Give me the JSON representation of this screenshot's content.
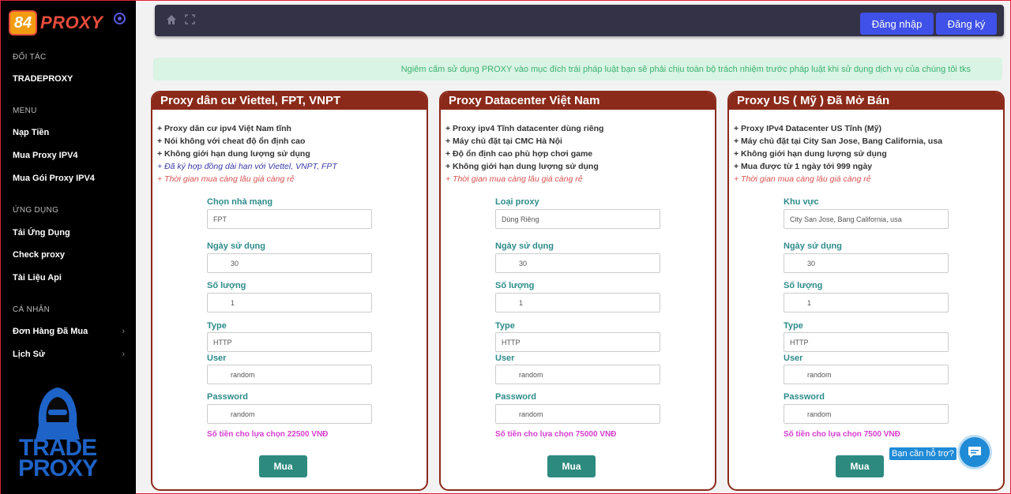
{
  "sidebar": {
    "brand": "PROXY",
    "logo_badge": "84",
    "sections": {
      "partner": "ĐỐI TÁC",
      "menu": "MENU",
      "apps": "ỨNG DỤNG",
      "personal": "CÁ NHÂN"
    },
    "partner_item": "TRADEPROXY",
    "menu_items": [
      "Nạp Tiền",
      "Mua Proxy IPV4",
      "Mua Gói Proxy IPV4"
    ],
    "app_items": [
      "Tải Ứng Dụng",
      "Check proxy",
      "Tài Liệu Api"
    ],
    "personal_items": [
      "Đơn Hàng Đã Mua",
      "Lịch Sử"
    ],
    "logo_line1": "TRADE",
    "logo_line2": "PROXY"
  },
  "topbar": {
    "login": "Đăng nhập",
    "register": "Đăng ký"
  },
  "notice": "Ngiêm cấm sử dụng PROXY vào mục đích trái pháp luật bạn sẽ phải chịu toàn bộ trách nhiệm trước pháp luật khi sử dụng dịch vụ của chúng tôi tks",
  "cards": [
    {
      "title": "Proxy dân cư Viettel, FPT, VNPT",
      "features": [
        "+ Proxy dân cư ipv4 Việt Nam tĩnh",
        "+ Nói không với cheat độ ổn định cao",
        "+ Không giới hạn dung lượng sử dụng"
      ],
      "highlight_blue": "+ Đã ký hợp đồng dài hạn với Viettel, VNPT, FPT",
      "highlight_red": "+ Thời gian mua càng lâu giá càng rẻ",
      "field1_label": "Chọn nhà mạng",
      "field1_value": "FPT",
      "days_label": "Ngày sử dụng",
      "days_value": "30",
      "qty_label": "Số lượng",
      "qty_value": "1",
      "type_label": "Type",
      "type_value": "HTTP",
      "user_label": "User",
      "user_value": "random",
      "pass_label": "Password",
      "pass_value": "random",
      "price": "Số tiền cho lựa chọn 22500 VNĐ",
      "buy": "Mua"
    },
    {
      "title": "Proxy Datacenter Việt Nam",
      "features": [
        "+ Proxy ipv4 Tĩnh datacenter dùng riêng",
        "+ Máy chủ đặt tại CMC Hà Nội",
        "+ Độ ổn định cao phù hợp chơi game",
        "+ Không giới hạn dung lượng sử dụng"
      ],
      "highlight_red": "+ Thời gian mua càng lâu giá càng rẻ",
      "field1_label": "Loại proxy",
      "field1_value": "Dùng Riêng",
      "days_label": "Ngày sử dụng",
      "days_value": "30",
      "qty_label": "Số lượng",
      "qty_value": "1",
      "type_label": "Type",
      "type_value": "HTTP",
      "user_label": "User",
      "user_value": "random",
      "pass_label": "Password",
      "pass_value": "random",
      "price": "Số tiền cho lựa chọn 75000 VNĐ",
      "buy": "Mua"
    },
    {
      "title": "Proxy US ( Mỹ ) Đã Mở Bán",
      "features": [
        "+ Proxy IPv4 Datacenter US Tĩnh (Mỹ)",
        "+ Máy chủ đặt tại City San Jose, Bang California, usa",
        "+ Không giới hạn dung lượng sử dụng",
        "+ Mua được từ 1 ngày tới 999 ngày"
      ],
      "highlight_red": "+ Thời gian mua càng lâu giá càng rẻ",
      "field1_label": "Khu vực",
      "field1_value": "City San Jose, Bang California, usa",
      "days_label": "Ngày sử dụng",
      "days_value": "30",
      "qty_label": "Số lượng",
      "qty_value": "1",
      "type_label": "Type",
      "type_value": "HTTP",
      "user_label": "User",
      "user_value": "random",
      "pass_label": "Password",
      "pass_value": "random",
      "price": "Số tiền cho lựa chọn 7500 VNĐ",
      "buy": "Mua"
    }
  ],
  "help": {
    "text": "Bạn cần hỗ trợ?"
  }
}
